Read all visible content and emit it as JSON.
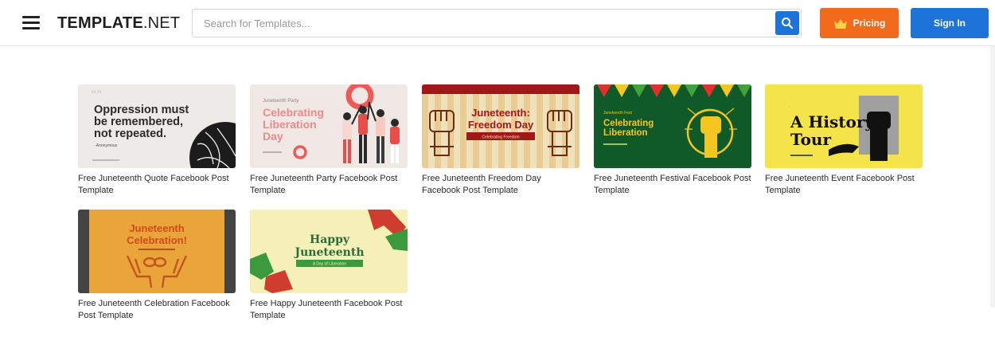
{
  "header": {
    "logo_bold": "TEMPLATE",
    "logo_light": ".NET",
    "search_placeholder": "Search for Templates...",
    "search_value": "",
    "pricing_label": "Pricing",
    "signin_label": "Sign In"
  },
  "colors": {
    "accent_blue": "#1e73d8",
    "accent_orange": "#f26a1b"
  },
  "icons": {
    "menu": "hamburger-icon",
    "search": "search-icon",
    "pricing": "crown-icon"
  },
  "templates": [
    {
      "title": "Free Juneteenth Quote Facebook Post Template",
      "thumb_lines": [
        "Oppression must",
        "be remembered,",
        "not repeated."
      ],
      "thumb_sub": "- Anonymous"
    },
    {
      "title": "Free Juneteenth Party Facebook Post Template",
      "thumb_small": "Juneteenth Party",
      "thumb_lines": [
        "Celebrating",
        "Liberation",
        "Day"
      ]
    },
    {
      "title": "Free Juneteenth Freedom Day Facebook Post Template",
      "thumb_lines": [
        "Juneteenth:",
        "Freedom Day"
      ],
      "thumb_sub": "Celebrating Freedom"
    },
    {
      "title": "Free Juneteenth Festival Facebook Post Template",
      "thumb_small": "Juneteenth Fest",
      "thumb_lines": [
        "Celebrating",
        "Liberation"
      ]
    },
    {
      "title": "Free Juneteenth Event Facebook Post Template",
      "thumb_lines": [
        "A History",
        "Tour"
      ]
    },
    {
      "title": "Free Juneteenth Celebration Facebook Post Template",
      "thumb_lines": [
        "Juneteenth",
        "Celebration!"
      ]
    },
    {
      "title": "Free Happy Juneteenth Facebook Post Template",
      "thumb_lines": [
        "Happy",
        "Juneteenth"
      ],
      "thumb_sub": "A Day of Liberation"
    }
  ]
}
